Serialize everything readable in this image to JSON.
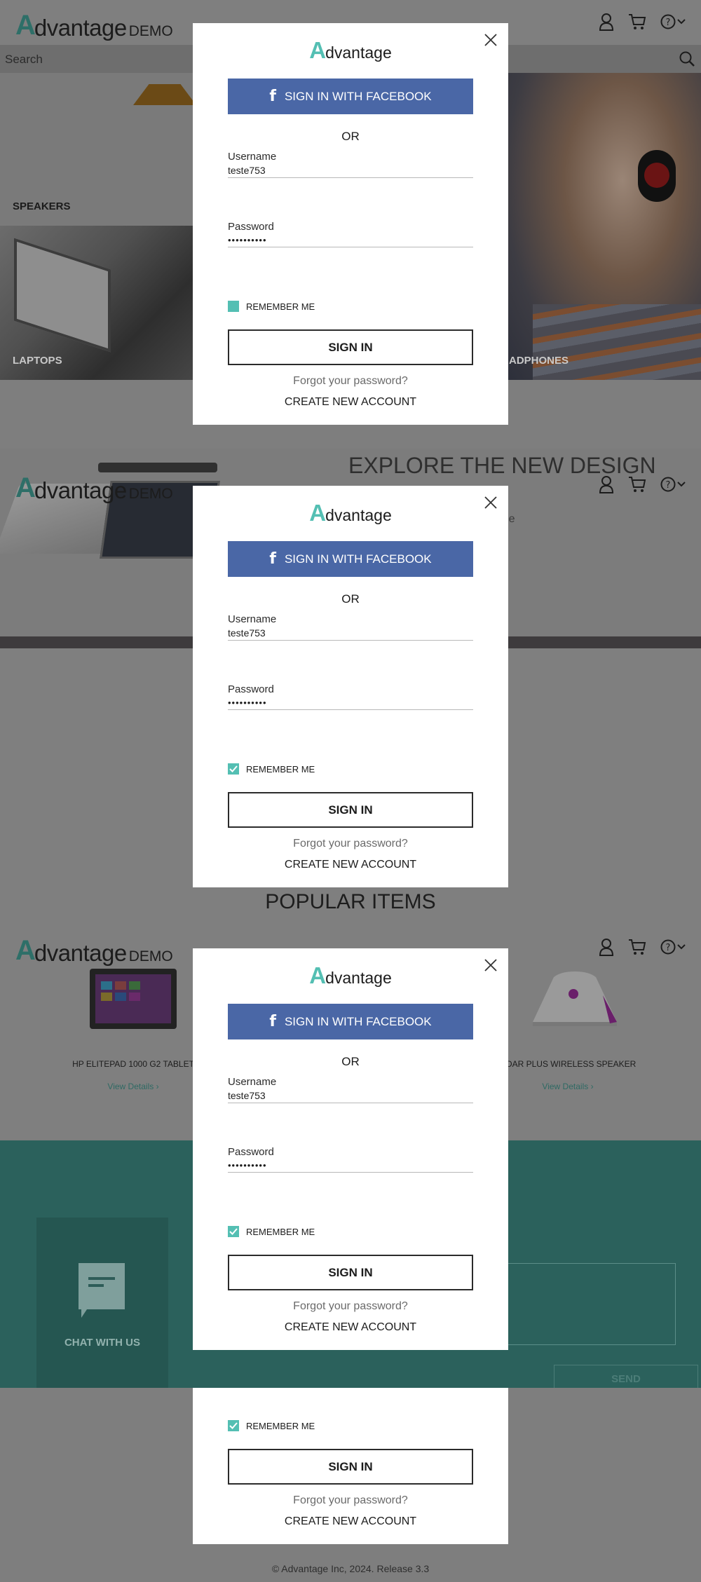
{
  "header": {
    "logo_text": "dvantage",
    "logo_mark": "A",
    "logo_demo": "DEMO",
    "icons": [
      "user-icon",
      "cart-icon",
      "help-icon",
      "chevron-down-icon"
    ]
  },
  "search": {
    "placeholder": "Search"
  },
  "categories": {
    "speakers": "SPEAKERS",
    "laptops": "LAPTOPS",
    "headphones": "ADPHONES"
  },
  "explore": {
    "heading": "EXPLORE THE NEW DESIGN",
    "subtext": "urable"
  },
  "popular": {
    "title": "POPULAR ITEMS",
    "items": [
      {
        "name": "HP ELITEPAD 1000 G2 TABLET",
        "link": "View Details"
      },
      {
        "name": "ROAR PLUS WIRELESS SPEAKER",
        "link": "View Details"
      }
    ]
  },
  "contact": {
    "chat_label": "CHAT WITH US",
    "send_label": "SEND"
  },
  "footer": {
    "copyright": "© Advantage Inc, 2024. Release 3.3"
  },
  "modal": {
    "logo_mark": "A",
    "logo_text": "dvantage",
    "facebook_label": "SIGN IN WITH FACEBOOK",
    "or_label": "OR",
    "username_label": "Username",
    "username_value": "teste753",
    "password_label": "Password",
    "password_value": "••••••••••",
    "remember_label": "REMEMBER ME",
    "signin_label": "SIGN IN",
    "forgot_label": "Forgot your password?",
    "create_label": "CREATE NEW ACCOUNT"
  },
  "colors": {
    "accent": "#54bfb3",
    "facebook": "#4a67a6",
    "contact_bg": "#2b615c",
    "overlay_gray": "#7e7e7e"
  }
}
